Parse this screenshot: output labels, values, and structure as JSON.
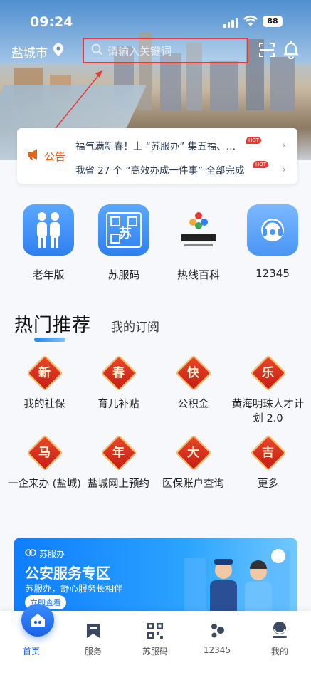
{
  "status": {
    "time": "09:24",
    "battery": "88"
  },
  "header": {
    "city": "盐城市",
    "search_placeholder": "请输入关键词"
  },
  "notices": [
    {
      "text": "福气满新春！上 “苏服办” 集五福、…",
      "badge": "HOT"
    },
    {
      "text": "我省 27 个 “高效办成一件事” 全部完成",
      "badge": "HOT"
    }
  ],
  "notice_label": "公告",
  "quick_entries": [
    {
      "label": "老年版",
      "icon": "elderly-couple-icon"
    },
    {
      "label": "苏服码",
      "icon": "qr-code-icon"
    },
    {
      "label": "热线百科",
      "icon": "hotline-wiki-logo"
    },
    {
      "label": "12345",
      "icon": "headset-icon"
    }
  ],
  "section_tabs": {
    "hot": "热门推荐",
    "subscribed": "我的订阅"
  },
  "services": [
    {
      "char": "新",
      "label": "我的社保"
    },
    {
      "char": "春",
      "label": "育儿补贴"
    },
    {
      "char": "快",
      "label": "公积金"
    },
    {
      "char": "乐",
      "label": "黄海明珠人才计划 2.0"
    },
    {
      "char": "马",
      "label": "一企来办 (盐城)"
    },
    {
      "char": "年",
      "label": "盐城网上预约"
    },
    {
      "char": "大",
      "label": "医保账户查询"
    },
    {
      "char": "吉",
      "label": "更多"
    }
  ],
  "banner": {
    "brand": "苏服办",
    "title": "公安服务专区",
    "subtitle": "苏服办，舒心服务长相伴",
    "button": "立即查看"
  },
  "tabbar": [
    {
      "label": "首页",
      "icon": "home-icon",
      "active": true
    },
    {
      "label": "服务",
      "icon": "bookmark-icon"
    },
    {
      "label": "苏服码",
      "icon": "qr-code-icon"
    },
    {
      "label": "12345",
      "icon": "dots-icon"
    },
    {
      "label": "我的",
      "icon": "person-icon"
    }
  ],
  "colors": {
    "accent": "#1a62e8",
    "notice": "#e8641b",
    "highlight_box": "#e53935"
  }
}
